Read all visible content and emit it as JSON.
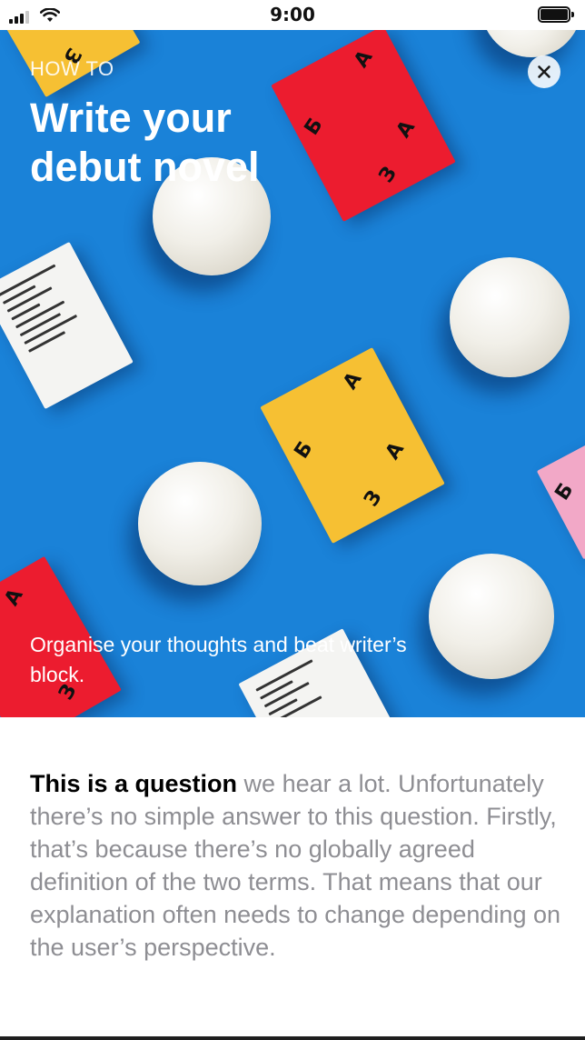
{
  "status_bar": {
    "time": "9:00",
    "signal_icon": "cellular-signal-icon",
    "wifi_icon": "wifi-icon",
    "battery_icon": "battery-icon"
  },
  "hero": {
    "eyebrow": "HOW TO",
    "title": "Write your debut novel",
    "subtitle": "Organise your thoughts and beat writer’s block.",
    "background_color": "#1a82d8",
    "close_icon": "close-icon"
  },
  "article": {
    "lead": "This is a question",
    "body": " we hear a lot. Unfortunately there’s no simple answer to this question. Firstly, that’s because there’s no globally agreed definition of the two terms. That means that our explanation often needs to change depending on the user’s perspective."
  },
  "card_letters": {
    "b": "Б",
    "a": "А",
    "z": "З"
  }
}
